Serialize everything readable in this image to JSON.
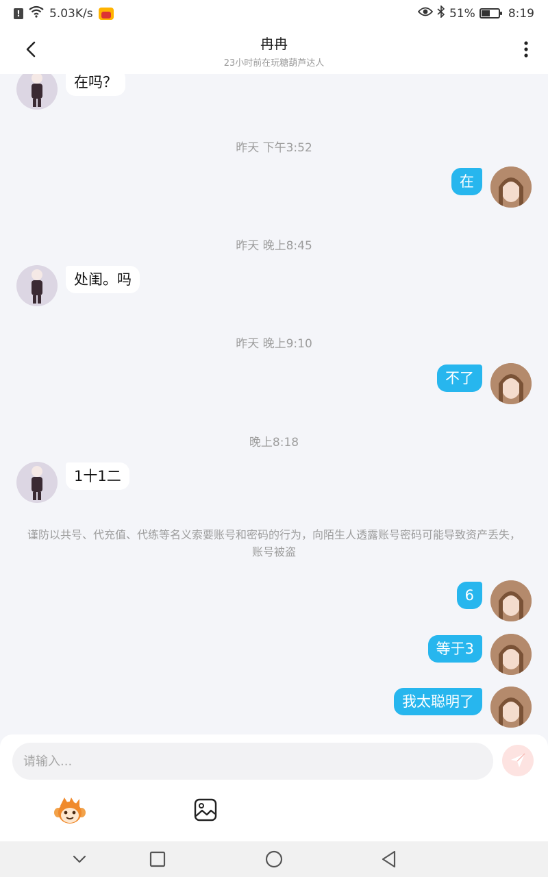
{
  "status_bar": {
    "network_speed": "5.03K/s",
    "battery_percent": "51%",
    "battery_level": 0.51,
    "time": "8:19"
  },
  "header": {
    "title": "冉冉",
    "subtitle": "23小时前在玩糖葫芦达人"
  },
  "messages": {
    "m1": "在吗？",
    "t1": "昨天 下午3:52",
    "m2": "在",
    "t2": "昨天 晚上8:45",
    "m3": "处闺。吗",
    "t3": "昨天 晚上9:10",
    "m4": "不了",
    "t4": "晚上8:18",
    "m5": "1十1二",
    "notice": "谨防以共号、代充值、代练等名义索要账号和密码的行为，向陌生人透露账号密码可能导致资产丢失，账号被盗",
    "m6": "6",
    "m7": "等于3",
    "m8": "我太聪明了"
  },
  "input": {
    "placeholder": "请输入..."
  },
  "colors": {
    "my_bubble": "#27b6ee",
    "other_bubble": "#ffffff",
    "background": "#f4f5f9"
  },
  "icons": {
    "back": "back-arrow-icon",
    "more": "more-vertical-icon",
    "send": "send-icon",
    "emoji": "monkey-emoji-icon",
    "image": "image-icon"
  }
}
